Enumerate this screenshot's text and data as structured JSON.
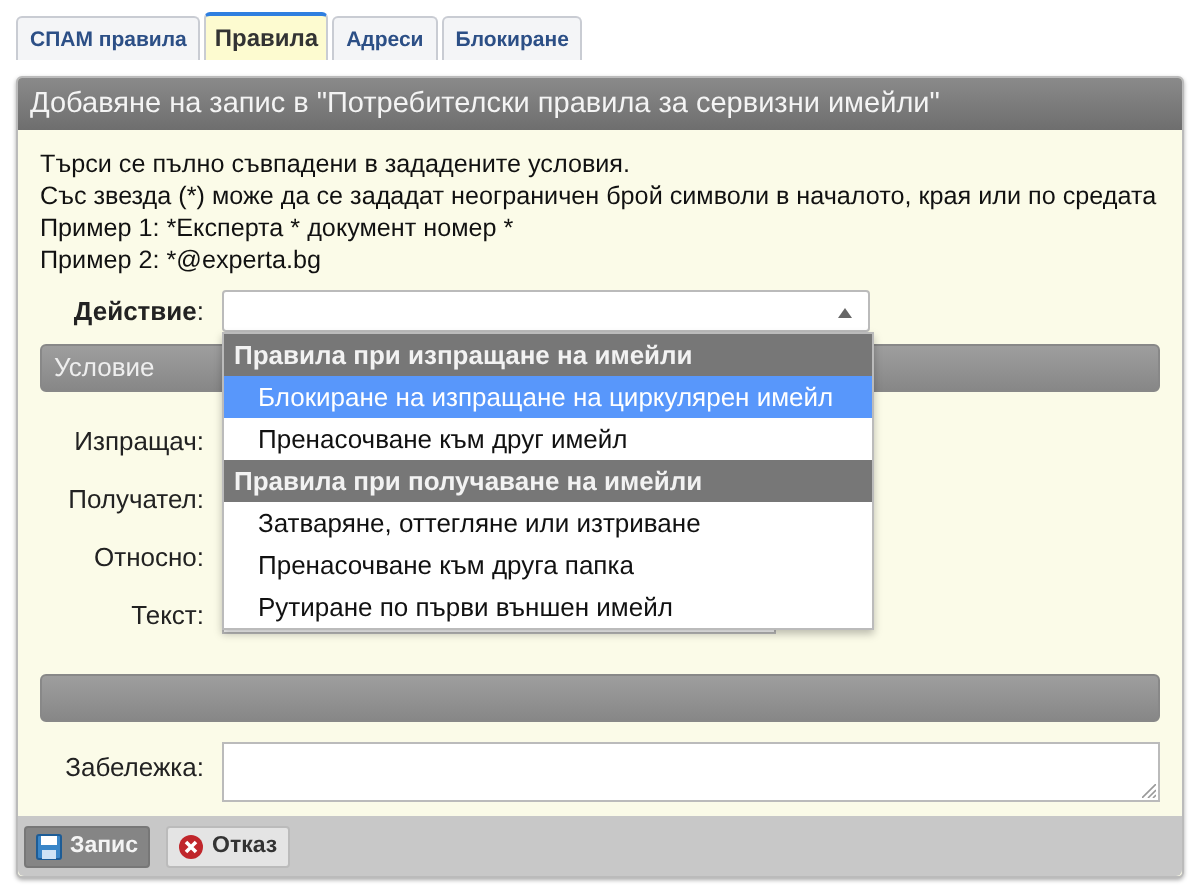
{
  "tabs": [
    {
      "label": "СПАМ правила",
      "selected": false
    },
    {
      "label": "Правила",
      "selected": true
    },
    {
      "label": "Адреси",
      "selected": false
    },
    {
      "label": "Блокиране",
      "selected": false
    }
  ],
  "panel": {
    "title": "Добавяне на запис в \"Потребителски правила за сервизни имейли\"",
    "instructions": [
      "Търси се пълно съвпадени в зададените условия.",
      "Със звезда (*) може да се зададат неограничен брой символи в началото, края или по средата",
      "Пример 1: *Експерта * документ номер *",
      "Пример 2: *@experta.bg"
    ],
    "action": {
      "label": "**Действие**:",
      "expanded": true,
      "groups": [
        {
          "label": "Правила при изпращане на имейли",
          "options": [
            {
              "label": "Блокиране на изпращане на циркулярен имейл",
              "selected": true
            },
            {
              "label": "Пренасочване към друг имейл",
              "selected": false
            }
          ]
        },
        {
          "label": "Правила при получаване на имейли",
          "options": [
            {
              "label": "Затваряне, оттегляне или изтриване",
              "selected": false
            },
            {
              "label": "Пренасочване към друга папка",
              "selected": false
            },
            {
              "label": "Рутиране по първи външен имейл",
              "selected": false
            }
          ]
        }
      ]
    },
    "condition_section": {
      "title": "Условие"
    },
    "condition_fields": [
      {
        "label": "Изпращач:"
      },
      {
        "label": "Получател:"
      },
      {
        "label": "Относно:"
      },
      {
        "label": "Текст:"
      }
    ],
    "note": {
      "label": "Забележка:"
    },
    "buttons": [
      {
        "label": "Запис",
        "kind": "save"
      },
      {
        "label": "Отказ",
        "kind": "cancel"
      }
    ]
  }
}
